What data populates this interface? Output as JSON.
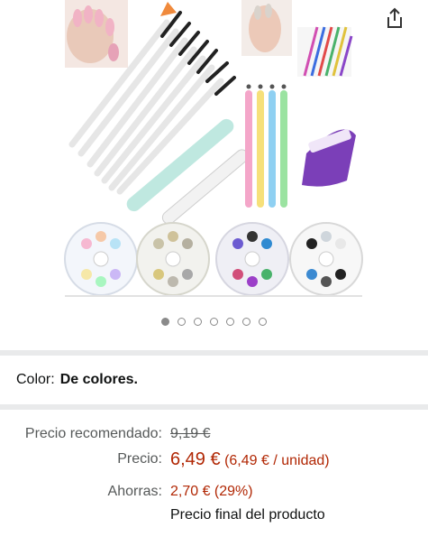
{
  "gallery": {
    "dots_total": 7,
    "active_dot": 0
  },
  "variation": {
    "label": "Color:",
    "value": "De colores."
  },
  "pricing": {
    "list_label": "Precio recomendado:",
    "list_value": "9,19 €",
    "price_label": "Precio:",
    "price_value": "6,49 €",
    "unit_price": "(6,49 € / unidad)",
    "savings_label": "Ahorras:",
    "savings_value": "2,70 € (29%)",
    "final_note": "Precio final del producto"
  },
  "colors": {
    "price_red": "#B12704",
    "divider": "#E9EAEB",
    "dot": "#8A8A8A"
  }
}
